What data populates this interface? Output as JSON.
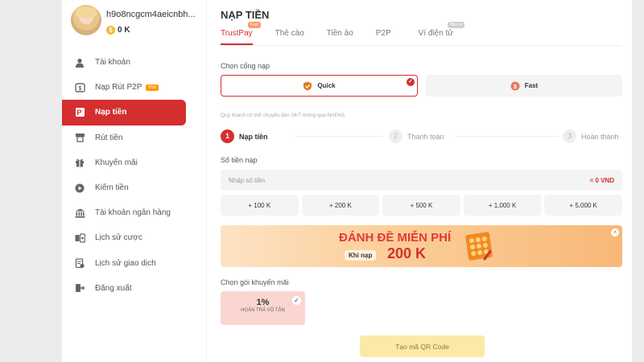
{
  "profile": {
    "username": "h9o8ncgcm4aeicnbh...",
    "balance": "0 K",
    "coin_symbol": "$"
  },
  "sidebar": {
    "items": [
      {
        "label": "Tài khoản",
        "icon": "user-icon"
      },
      {
        "label": "Nạp Rút P2P",
        "icon": "p2p-icon",
        "badge": "Hot"
      },
      {
        "label": "Nạp tiền",
        "icon": "deposit-icon",
        "active": true
      },
      {
        "label": "Rút tiền",
        "icon": "withdraw-icon"
      },
      {
        "label": "Khuyến mãi",
        "icon": "gift-icon"
      },
      {
        "label": "Kiếm tiền",
        "icon": "play-icon"
      },
      {
        "label": "Tài khoản ngân hàng",
        "icon": "bank-icon"
      },
      {
        "label": "Lịch sử cược",
        "icon": "bet-history-icon"
      },
      {
        "label": "Lịch sử giao dịch",
        "icon": "transaction-history-icon"
      },
      {
        "label": "Đăng xuất",
        "icon": "logout-icon"
      }
    ]
  },
  "main": {
    "title": "NẠP TIỀN",
    "tabs": [
      {
        "label": "TrustPay",
        "badge": "Fast",
        "active": true
      },
      {
        "label": "Thẻ cào"
      },
      {
        "label": "Tiền ảo"
      },
      {
        "label": "P2P"
      },
      {
        "label": "Ví điện tử",
        "badge": "Bảo trì"
      }
    ],
    "gateway_label": "Chọn cổng nạp",
    "gateways": [
      {
        "label": "Quick",
        "selected": true
      },
      {
        "label": "Fast"
      }
    ],
    "note": "Quý khách có thể chuyển tiền 24/7 thông qua NAPAS",
    "steps": [
      {
        "num": "1",
        "label": "Nạp tiền"
      },
      {
        "num": "2",
        "label": "Thanh toán"
      },
      {
        "num": "3",
        "label": "Hoàn thành"
      }
    ],
    "amount_label": "Số tiền nạp",
    "amount_placeholder": "Nhập số tiền",
    "amount_vnd": "= 0 VND",
    "quick_amounts": [
      "+ 100 K",
      "+ 200 K",
      "+ 500 K",
      "+ 1,000 K",
      "+ 5,000 K"
    ],
    "banner": {
      "title": "ĐÁNH ĐỀ MIỄN PHÍ",
      "sub": "Khi nạp",
      "amount": "200 K",
      "close": "×"
    },
    "promo_label": "Chọn gói khuyến mãi",
    "promo": {
      "pct": "1%",
      "desc": "HOÀN TRẢ VÔ TẬN",
      "check": "✓"
    },
    "qr_button": "Tạo mã QR Code"
  },
  "colors": {
    "accent": "#d32f2f",
    "qr_button_bg": "#fbe9a6",
    "promo_bg": "#fbd6d0"
  }
}
